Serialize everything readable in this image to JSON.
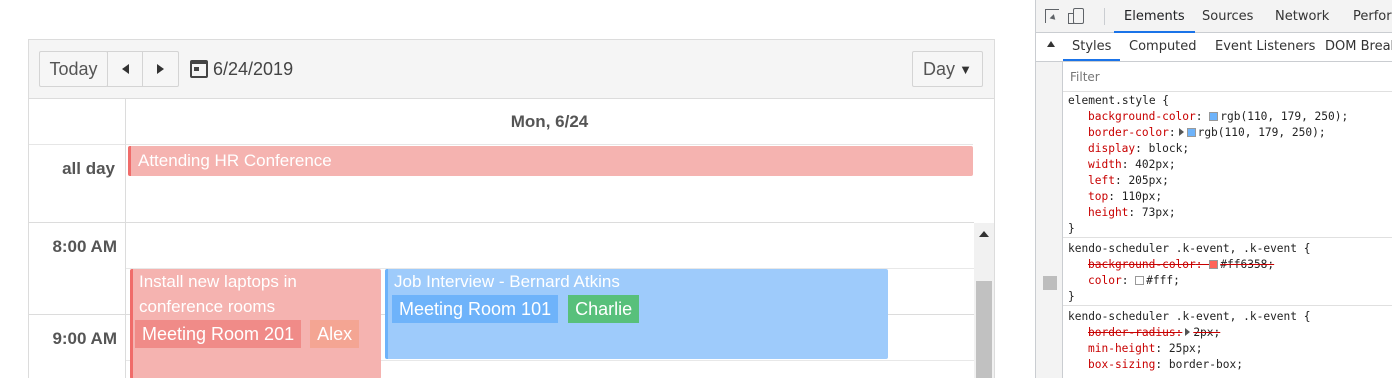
{
  "scheduler": {
    "toolbar": {
      "today_label": "Today",
      "date_label": "6/24/2019",
      "view_label": "Day",
      "view_caret": "▼"
    },
    "header": {
      "day_label": "Mon, 6/24"
    },
    "allday": {
      "label": "all day",
      "event_title": "Attending HR Conference"
    },
    "times": {
      "t8": "8:00 AM",
      "t9": "9:00 AM"
    },
    "events": [
      {
        "title": "Install new laptops in conference rooms",
        "room": "Meeting Room 201",
        "attendee": "Alex"
      },
      {
        "title": "Job Interview - Bernard Atkins",
        "room": "Meeting Room 101",
        "attendee": "Charlie"
      }
    ]
  },
  "devtools": {
    "tabs": [
      "Elements",
      "Sources",
      "Network",
      "Perfor"
    ],
    "subtabs": [
      "Styles",
      "Computed",
      "Event Listeners",
      "DOM Break"
    ],
    "filter_placeholder": "Filter",
    "colors": {
      "accent_blue": "#6eb3fa",
      "event_red": "#ff6358",
      "white": "#fff"
    },
    "rule1": {
      "selector": "element.style {",
      "decls": [
        {
          "prop": "background-color",
          "val": "rgb(110, 179, 250);"
        },
        {
          "prop": "border-color",
          "val": "rgb(110, 179, 250);"
        },
        {
          "prop": "display",
          "val": "block;"
        },
        {
          "prop": "width",
          "val": "402px;"
        },
        {
          "prop": "left",
          "val": "205px;"
        },
        {
          "prop": "top",
          "val": "110px;"
        },
        {
          "prop": "height",
          "val": "73px;"
        }
      ],
      "close": "}"
    },
    "rule2": {
      "selector": "kendo-scheduler .k-event, .k-event {",
      "decls": [
        {
          "prop": "background-color",
          "val": "#ff6358;"
        },
        {
          "prop": "color",
          "val": "#fff;"
        }
      ],
      "close": "}"
    },
    "rule3": {
      "selector": "kendo-scheduler .k-event, .k-event {",
      "decls": [
        {
          "prop": "border-radius",
          "val": "2px;"
        },
        {
          "prop": "min-height",
          "val": "25px;"
        },
        {
          "prop": "box-sizing",
          "val": "border-box;"
        }
      ]
    }
  }
}
